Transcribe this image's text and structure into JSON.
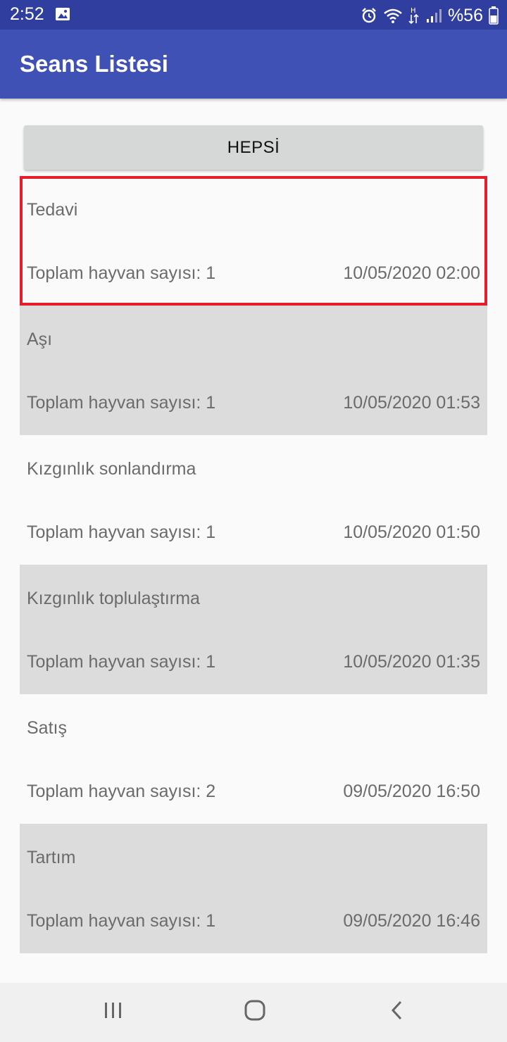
{
  "status_bar": {
    "time": "2:52",
    "battery": "%56",
    "icons": [
      "image-icon",
      "alarm-icon",
      "wifi-icon",
      "data-arrows-icon",
      "signal-icon",
      "battery-icon"
    ]
  },
  "app_bar": {
    "title": "Seans Listesi"
  },
  "filter_button": {
    "label": "HEPSİ"
  },
  "sessions": [
    {
      "name": "Tedavi",
      "count": "Toplam hayvan sayısı: 1",
      "date": "10/05/2020 02:00"
    },
    {
      "name": "Aşı",
      "count": "Toplam hayvan sayısı: 1",
      "date": "10/05/2020 01:53"
    },
    {
      "name": "Kızgınlık sonlandırma",
      "count": "Toplam hayvan sayısı: 1",
      "date": "10/05/2020 01:50"
    },
    {
      "name": "Kızgınlık toplulaştırma",
      "count": "Toplam hayvan sayısı: 1",
      "date": "10/05/2020 01:35"
    },
    {
      "name": "Satış",
      "count": "Toplam hayvan sayısı: 2",
      "date": "09/05/2020 16:50"
    },
    {
      "name": "Tartım",
      "count": "Toplam hayvan sayısı: 1",
      "date": "09/05/2020 16:46"
    }
  ],
  "colors": {
    "status_bar": "#303f9f",
    "app_bar": "#3f51b5",
    "alt_row": "#dcdcdc",
    "selection_outline": "#e31e2a"
  },
  "nav_bar": {
    "icons": [
      "recent-apps-icon",
      "home-icon",
      "back-icon"
    ]
  }
}
